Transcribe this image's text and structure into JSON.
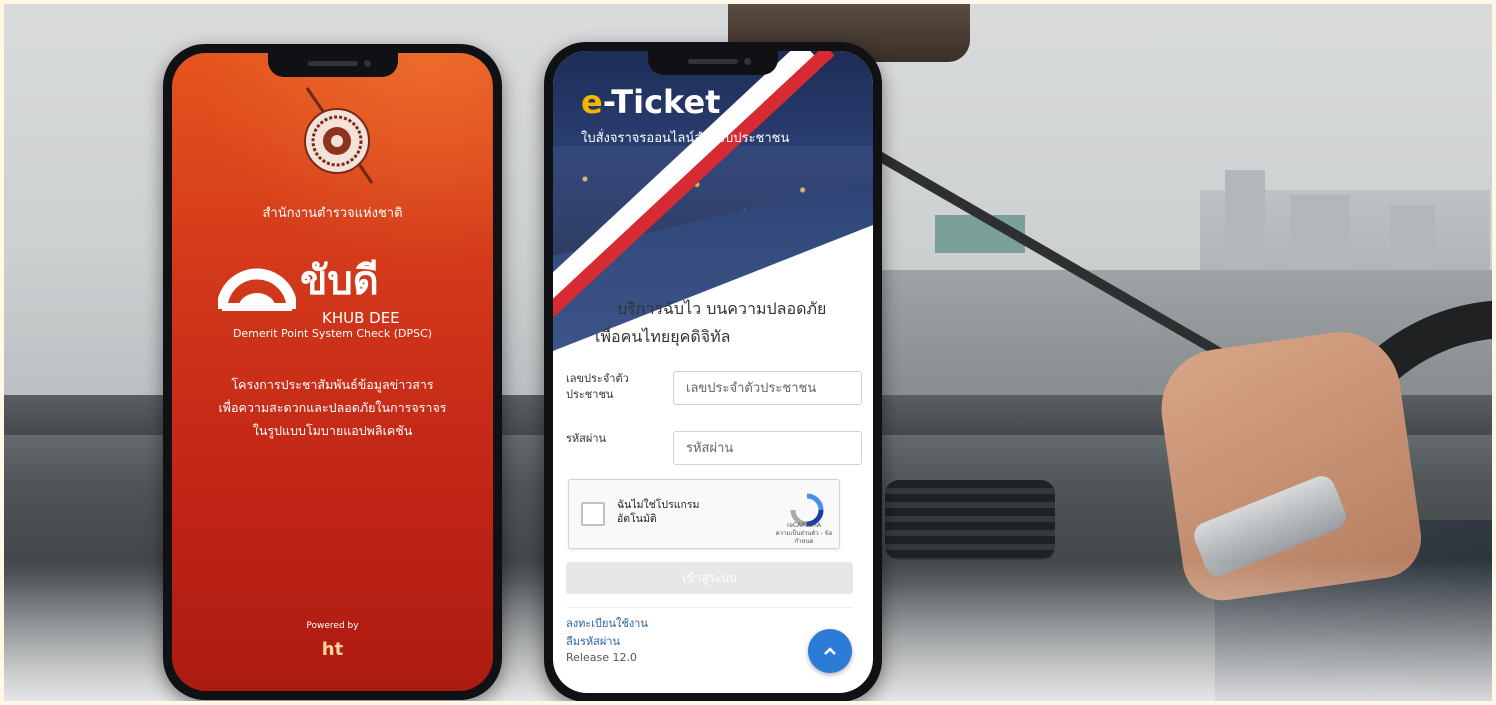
{
  "left_phone": {
    "agency": "สำนักงานตำรวจแห่งชาติ",
    "app_name_th": "ขับดี",
    "app_name_en": "KHUB DEE",
    "app_subtitle": "Demerit Point System Check (DPSC)",
    "description": [
      "โครงการประชาสัมพันธ์ข้อมูลข่าวสาร",
      "เพื่อความสะดวกและปลอดภัยในการจราจร",
      "ในรูปแบบโมบายแอปพลิเคชัน"
    ],
    "powered_by": "Powered by",
    "powered_brand": "ht",
    "colors": {
      "primary": "#d2381a",
      "dark": "#ac1b12"
    }
  },
  "right_phone": {
    "title_prefix": "e",
    "title_rest": "-Ticket",
    "subtitle": "ใบสั่งจราจรออนไลน์สำหรับประชาชน",
    "tagline_1": "บริการฉับไว บนความปลอดภัย",
    "tagline_2": "เพื่อคนไทยยุคดิจิทัล",
    "id_label": "เลขประจำตัว ประชาชน",
    "id_placeholder": "เลขประจำตัวประชาชน",
    "password_label": "รหัสผ่าน",
    "password_placeholder": "รหัสผ่าน",
    "captcha_text": "ฉันไม่ใช่โปรแกรม อัตโนมัติ",
    "captcha_brand": "reCAPTCHA",
    "captcha_terms": "ความเป็นส่วนตัว - ข้อกำหนด",
    "login_label": "เข้าสู่ระบบ",
    "register_link": "ลงทะเบียนใช้งาน",
    "forgot_link": "ลืมรหัสผ่าน",
    "release": "Release 12.0",
    "fab_icon": "chevron-up-icon",
    "colors": {
      "accent": "#2c7bd6",
      "title_accent": "#f4b400",
      "stripe": "#d62b33"
    }
  }
}
